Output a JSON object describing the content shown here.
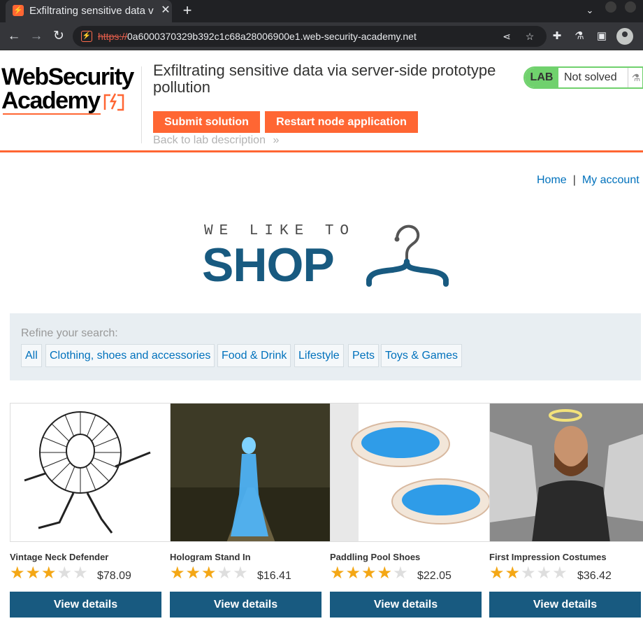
{
  "browser": {
    "tab_title": "Exfiltrating sensitive data via server-side prototype pollution",
    "url_scheme": "https://",
    "url_rest": "0a6000370329b392c1c68a28006900e1.web-security-academy.net",
    "icons": [
      "back-arrow-icon",
      "forward-arrow-icon",
      "reload-icon",
      "share-icon",
      "star-icon",
      "extensions-icon",
      "flask-icon",
      "sidepanel-icon",
      "profile-icon"
    ]
  },
  "academy": {
    "logo_line1": "WebSecurity",
    "logo_line2": "Academy",
    "lab_title": "Exfiltrating sensitive data via server-side prototype pollution",
    "submit_label": "Submit solution",
    "restart_label": "Restart node application",
    "back_label": "Back to lab description",
    "status_tag": "LAB",
    "status_text": "Not solved",
    "accent_color": "#ff6633",
    "status_color": "#70d16d"
  },
  "shop": {
    "nav": {
      "home": "Home",
      "separator": "|",
      "account": "My account"
    },
    "logo_small": "WE LIKE TO",
    "logo_big": "SHOP",
    "brand_color": "#185a80",
    "refine_label": "Refine your search:",
    "filters": [
      "All",
      "Clothing, shoes and accessories",
      "Food & Drink",
      "Lifestyle",
      "Pets",
      "Toys & Games"
    ],
    "products": [
      {
        "name": "Vintage Neck Defender",
        "rating": 3,
        "price": "$78.09",
        "button": "View details"
      },
      {
        "name": "Hologram Stand In",
        "rating": 3,
        "price": "$16.41",
        "button": "View details"
      },
      {
        "name": "Paddling Pool Shoes",
        "rating": 4,
        "price": "$22.05",
        "button": "View details"
      },
      {
        "name": "First Impression Costumes",
        "rating": 2,
        "price": "$36.42",
        "button": "View details"
      }
    ]
  }
}
